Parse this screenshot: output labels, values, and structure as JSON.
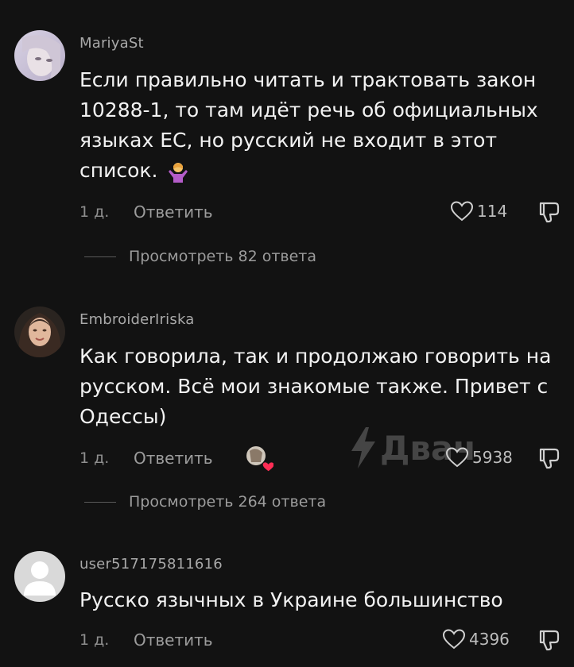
{
  "comments": [
    {
      "username": "MariyaSt",
      "text": "Если правильно читать и трактовать закон 10288-1, то там идёт речь об официальных языках ЕС, но русский не входит в этот список.",
      "time": "1 д.",
      "reply_label": "Ответить",
      "likes": "114",
      "view_replies": "Просмотреть 82 ответа",
      "emoji_icon": "shrug-person-icon"
    },
    {
      "username": "EmbroiderIriska",
      "text": "Как говорила, так и продолжаю говорить на русском. Всё мои знакомые также. Привет с Одессы)",
      "time": "1 д.",
      "reply_label": "Ответить",
      "likes": "5938",
      "view_replies": "Просмотреть 264 ответа",
      "liked_by_creator_icon": "creator-liked-avatar-icon"
    },
    {
      "username": "user517175811616",
      "text": "Русско язычных в Украине большинство",
      "time": "1 д.",
      "reply_label": "Ответить",
      "likes": "4396"
    }
  ],
  "watermark": {
    "text": "Двач",
    "icon": "lightning-icon"
  }
}
